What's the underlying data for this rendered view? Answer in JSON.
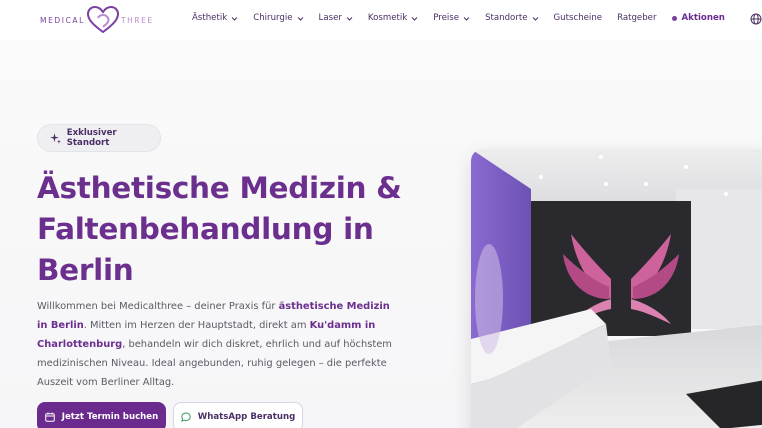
{
  "brand": {
    "logo_left": "MEDICAL",
    "logo_right": "THREE",
    "accent": "#6b2f8d"
  },
  "nav": {
    "items": [
      {
        "label": "Ästhetik",
        "dropdown": true
      },
      {
        "label": "Chirurgie",
        "dropdown": true
      },
      {
        "label": "Laser",
        "dropdown": true
      },
      {
        "label": "Kosmetik",
        "dropdown": true
      },
      {
        "label": "Preise",
        "dropdown": true
      },
      {
        "label": "Standorte",
        "dropdown": true
      },
      {
        "label": "Gutscheine",
        "dropdown": false
      },
      {
        "label": "Ratgeber",
        "dropdown": false
      }
    ],
    "action_label": "Aktionen",
    "language_icon": "globe-icon"
  },
  "hero": {
    "badge": "Exklusiver Standort",
    "headline_lines": [
      "Ästhetische Medizin &",
      "Faltenbehandlung in",
      "Berlin"
    ],
    "intro": {
      "t1": "Willkommen bei Medicalthree – deiner Praxis für ",
      "b1": "ästhetische Medizin in Berlin",
      "t2": ". Mitten im Herzen der Hauptstadt, direkt am ",
      "b2": "Ku'damm in Charlottenburg",
      "t3": ", behandeln wir dich diskret, ehrlich und auf höchstem medizinischen Niveau. Ideal angebunden, ruhig gelegen – die perfekte Auszeit vom Berliner Alltag."
    },
    "primary_button": "Jetzt Termin buchen",
    "secondary_button": "WhatsApp Beratung"
  }
}
